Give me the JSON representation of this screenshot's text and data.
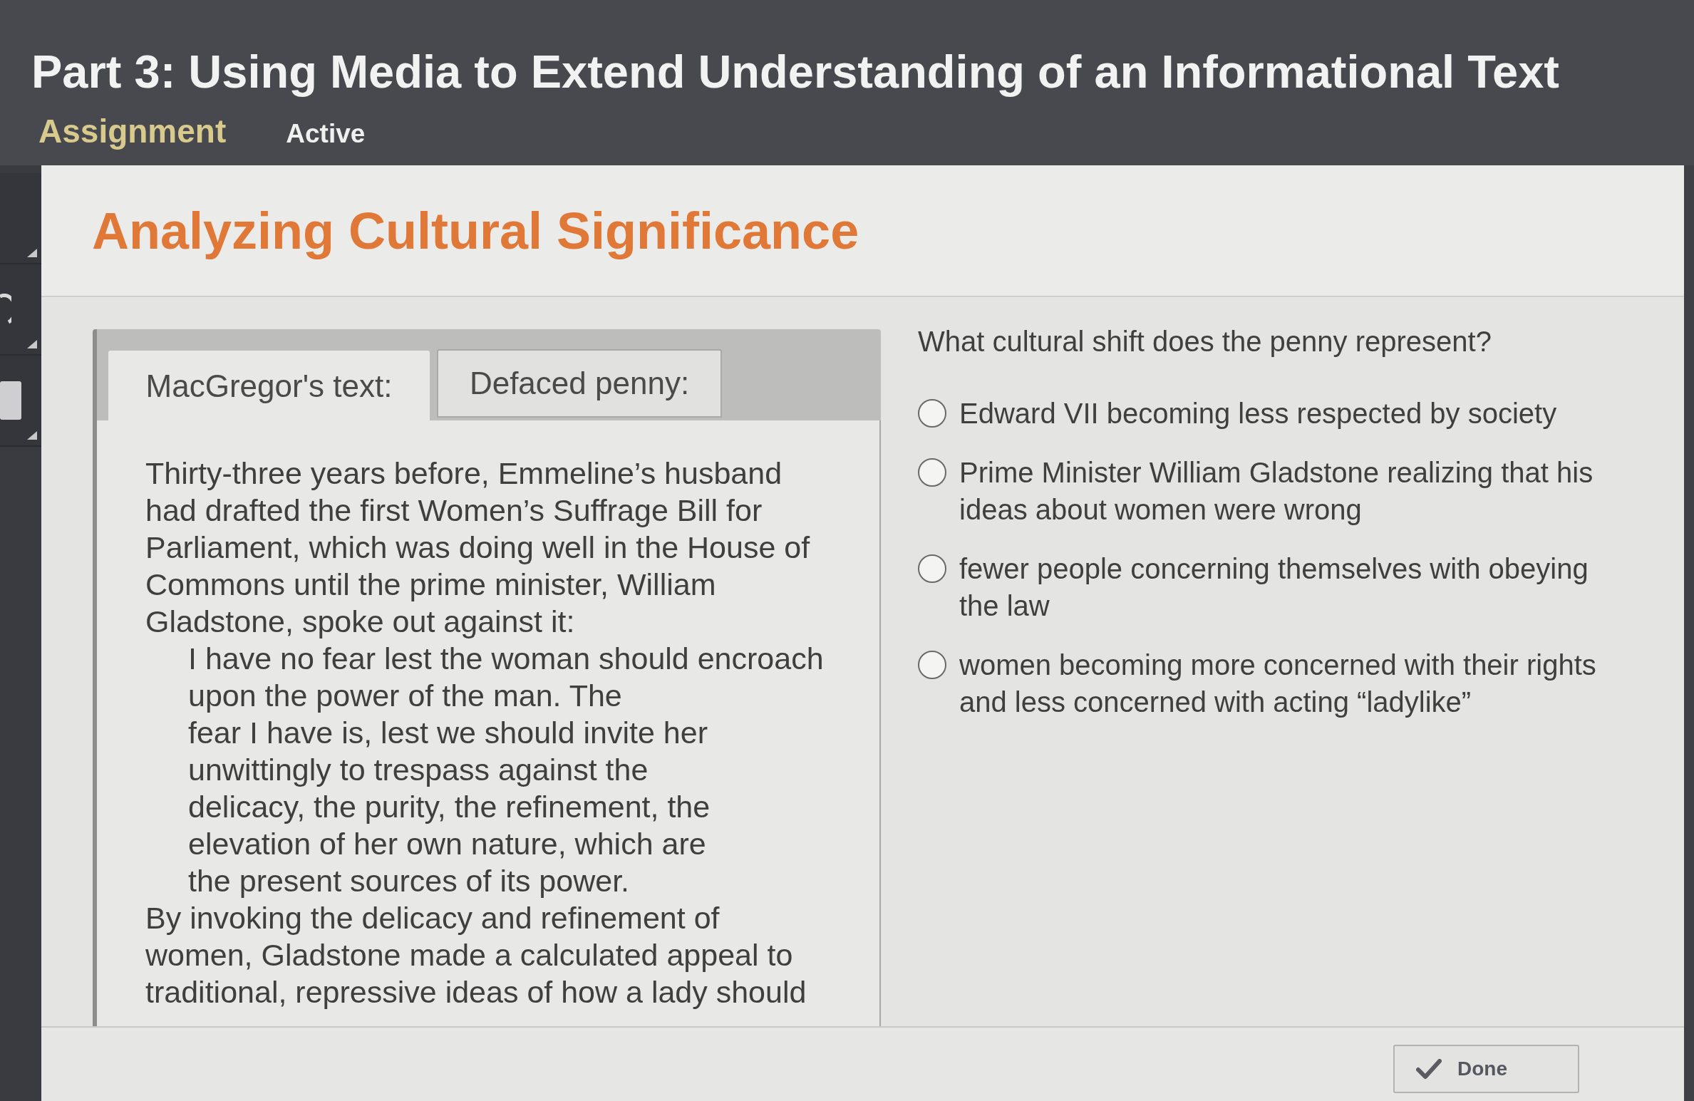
{
  "header": {
    "title": "Part 3: Using Media to Extend Understanding of an Informational Text",
    "category": "Assignment",
    "status": "Active"
  },
  "activity": {
    "title": "Analyzing Cultural Significance",
    "reader": {
      "tabs": [
        {
          "label": "MacGregor's text:",
          "selected": true
        },
        {
          "label": "Defaced penny:",
          "selected": false
        }
      ],
      "blocks": [
        {
          "kind": "paragraph",
          "text": "Thirty-three years before, Emmeline’s husband\nhad drafted the first Women’s Suffrage Bill for\nParliament, which was doing well in the House of\nCommons until the prime minister, William\nGladstone, spoke out against it:"
        },
        {
          "kind": "quote",
          "text": "I have no fear lest the woman should encroach\nupon the power of the man. The\nfear I have is, lest we should invite her\nunwittingly to trespass against the\ndelicacy, the purity, the refinement, the\nelevation of her own nature, which are\nthe present sources of its power."
        },
        {
          "kind": "paragraph",
          "text": "By invoking the delicacy and refinement of\nwomen, Gladstone made a calculated appeal to\ntraditional, repressive ideas of how a lady should"
        }
      ]
    },
    "question": {
      "prompt": "What cultural shift does the penny represent?",
      "options": [
        {
          "label": "Edward VII becoming less respected by society",
          "selected": false
        },
        {
          "label": "Prime Minister William Gladstone realizing that his ideas about women were wrong",
          "selected": false
        },
        {
          "label": "fewer people concerning themselves with obeying the law",
          "selected": false
        },
        {
          "label": "women becoming more concerned with their rights and less concerned with acting “ladylike”",
          "selected": false
        }
      ]
    },
    "done_button": {
      "label": "Done"
    }
  }
}
